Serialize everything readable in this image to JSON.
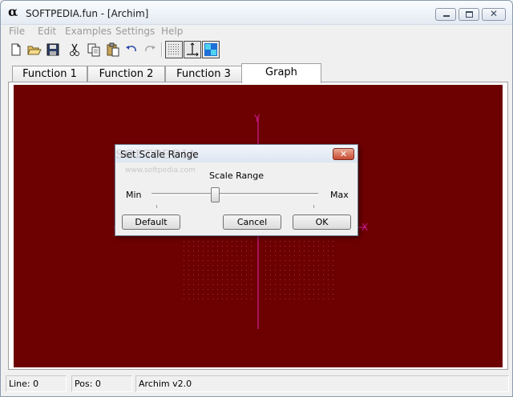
{
  "window": {
    "title": "SOFTPEDIA.fun - [Archim]",
    "app_icon": "alpha-icon",
    "controls": {
      "minimize": "minimize-icon",
      "maximize": "maximize-icon",
      "close": "✕"
    }
  },
  "menu": {
    "items": [
      {
        "label": "File"
      },
      {
        "label": "Edit"
      },
      {
        "label": "Examples"
      },
      {
        "label": "Settings"
      },
      {
        "label": "Help"
      }
    ]
  },
  "toolbar": {
    "buttons": [
      {
        "name": "new-file-icon"
      },
      {
        "name": "open-folder-icon"
      },
      {
        "name": "save-icon"
      },
      {
        "name": "cut-icon"
      },
      {
        "name": "copy-icon"
      },
      {
        "name": "paste-icon"
      },
      {
        "name": "undo-icon"
      },
      {
        "name": "redo-icon"
      },
      {
        "name": "grid-toggle-icon",
        "pressed": true
      },
      {
        "name": "axes-toggle-icon",
        "pressed": true
      },
      {
        "name": "color-fill-icon",
        "pressed": true
      }
    ]
  },
  "tabs": [
    {
      "label": "Function 1",
      "active": false
    },
    {
      "label": "Function 2",
      "active": false
    },
    {
      "label": "Function 3",
      "active": false
    },
    {
      "label": "Graph",
      "active": true
    }
  ],
  "graph": {
    "background_color": "#6d0000",
    "axis_color": "#c8198a",
    "x_axis_label": "X",
    "y_axis_label": "Y"
  },
  "dialog": {
    "title": "Set Scale Range",
    "watermark": "SOFTPEDIA",
    "watermark_sub": "www.softpedia.com",
    "close": "✕",
    "heading": "Scale Range",
    "min_label": "Min",
    "max_label": "Max",
    "slider_fraction": 0.38,
    "buttons": {
      "default": "Default",
      "cancel": "Cancel",
      "ok": "OK"
    }
  },
  "status": {
    "line": "Line: 0",
    "pos": "Pos: 0",
    "version": "Archim v2.0"
  }
}
